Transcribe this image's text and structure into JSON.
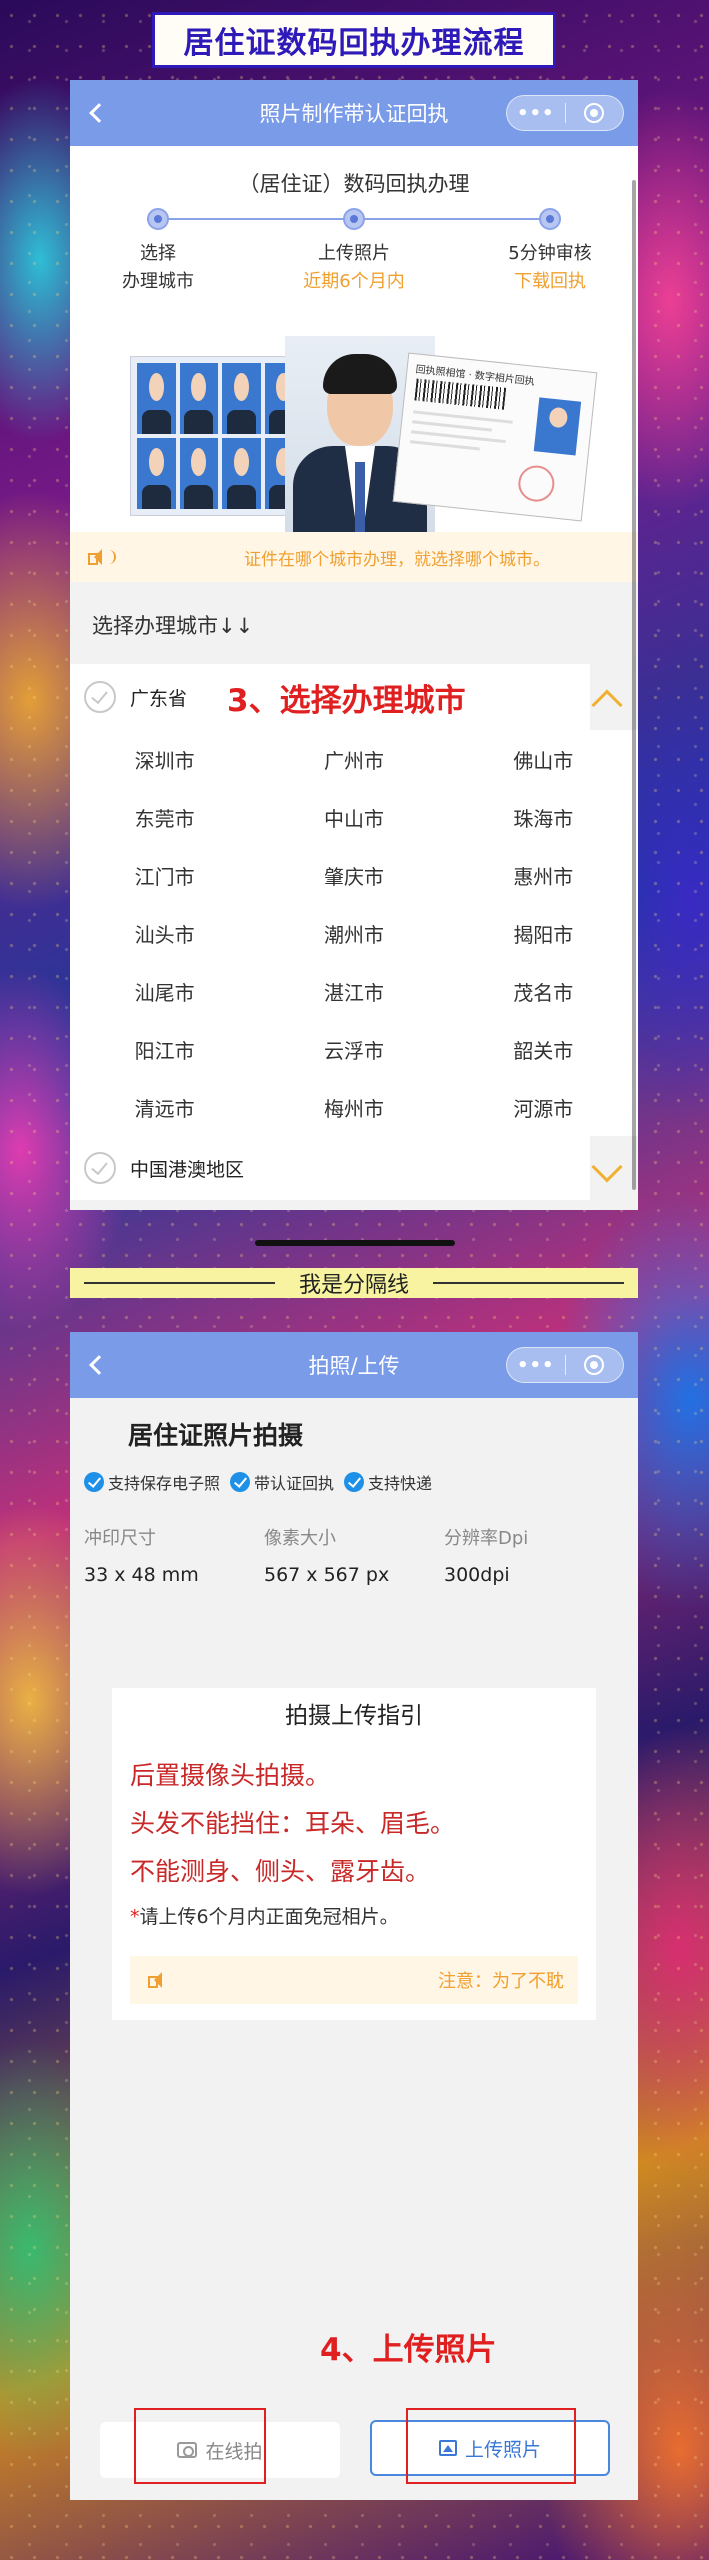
{
  "banner": {
    "title": "居住证数码回执办理流程"
  },
  "panel1": {
    "nav": {
      "title": "照片制作带认证回执",
      "more_label": "•••"
    },
    "flow_title": "（居住证）数码回执办理",
    "steps": [
      {
        "title": "选择",
        "sub": "办理城市"
      },
      {
        "title": "上传照片",
        "sub": "近期6个月内"
      },
      {
        "title": "5分钟审核",
        "sub": "下载回执"
      }
    ],
    "illustration": {
      "receipt_header": "回执照相馆 · 数字相片回执"
    },
    "notice": "证件在哪个城市办理，就选择哪个城市。",
    "city_heading": "选择办理城市↓↓",
    "province": {
      "name": "广东省",
      "annotation": "3、选择办理城市"
    },
    "cities": [
      "深圳市",
      "广州市",
      "佛山市",
      "东莞市",
      "中山市",
      "珠海市",
      "江门市",
      "肇庆市",
      "惠州市",
      "汕头市",
      "潮州市",
      "揭阳市",
      "汕尾市",
      "湛江市",
      "茂名市",
      "阳江市",
      "云浮市",
      "韶关市",
      "清远市",
      "梅州市",
      "河源市"
    ],
    "region2": {
      "name": "中国港澳地区"
    }
  },
  "separator": {
    "text": "我是分隔线"
  },
  "panel2": {
    "nav": {
      "title": "拍照/上传",
      "more_label": "•••"
    },
    "info_title": "居住证照片拍摄",
    "tags": [
      "支持保存电子照",
      "带认证回执",
      "支持快递"
    ],
    "specs": [
      {
        "label": "冲印尺寸",
        "value": "33 x 48 mm"
      },
      {
        "label": "像素大小",
        "value": "567 x 567 px"
      },
      {
        "label": "分辨率Dpi",
        "value": "300dpi"
      }
    ],
    "guide": {
      "title": "拍摄上传指引",
      "lines": [
        "后置摄像头拍摄。",
        "头发不能挡住：耳朵、眉毛。",
        "不能测身、侧头、露牙齿。"
      ],
      "note_star": "*",
      "note": "请上传6个月内正面免冠相片。",
      "warning": "注意：为了不耽"
    },
    "annotation": "4、上传照片",
    "buttons": {
      "camera": "在线拍",
      "upload": "上传照片"
    }
  }
}
